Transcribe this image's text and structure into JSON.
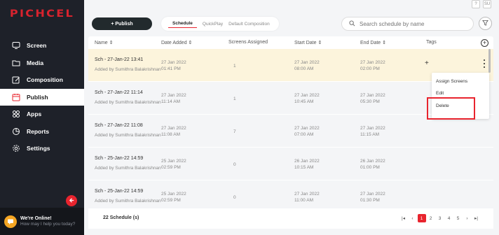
{
  "app": {
    "brand": "PICHCEL",
    "help_label": "?",
    "user_initials": "SU",
    "accent_color": "#e8242e",
    "sidebar_bg": "#1e2129"
  },
  "sidebar": {
    "items": [
      {
        "label": "Screen",
        "icon": "monitor-icon"
      },
      {
        "label": "Media",
        "icon": "folder-icon"
      },
      {
        "label": "Composition",
        "icon": "edit-icon"
      },
      {
        "label": "Publish",
        "icon": "calendar-icon",
        "active": true
      },
      {
        "label": "Apps",
        "icon": "apps-grid-icon"
      },
      {
        "label": "Reports",
        "icon": "pie-chart-icon"
      },
      {
        "label": "Settings",
        "icon": "gear-icon"
      }
    ],
    "chat": {
      "title": "We're Online!",
      "subtitle": "How may I help you today?"
    }
  },
  "toolbar": {
    "publish_label": "+ Publish",
    "tabs": [
      "Schedule",
      "QuickPlay",
      "Default Composition"
    ],
    "active_tab": "Schedule",
    "search_placeholder": "Search schedule by name"
  },
  "table": {
    "columns": [
      "Name",
      "Date Added",
      "Screens Assigned",
      "Start Date",
      "End Date",
      "Tags"
    ],
    "rows": [
      {
        "name": "Sch - 27-Jan-22 13:41",
        "added_by": "Added by Sumithra Balakrishnan",
        "date_added": "27 Jan 2022",
        "time_added": "01:41 PM",
        "screens": "1",
        "start_date": "27 Jan 2022",
        "start_time": "08:00 AM",
        "end_date": "27 Jan 2022",
        "end_time": "02:00 PM"
      },
      {
        "name": "Sch - 27-Jan-22 11:14",
        "added_by": "Added by Sumithra Balakrishnan",
        "date_added": "27 Jan 2022",
        "time_added": "11:14 AM",
        "screens": "1",
        "start_date": "27 Jan 2022",
        "start_time": "10:45 AM",
        "end_date": "27 Jan 2022",
        "end_time": "05:30 PM"
      },
      {
        "name": "Sch - 27-Jan-22 11:08",
        "added_by": "Added by Sumithra Balakrishnan",
        "date_added": "27 Jan 2022",
        "time_added": "11:08 AM",
        "screens": "7",
        "start_date": "27 Jan 2022",
        "start_time": "07:00 AM",
        "end_date": "27 Jan 2022",
        "end_time": "11:15 AM"
      },
      {
        "name": "Sch - 25-Jan-22 14:59",
        "added_by": "Added by Sumithra Balakrishnan",
        "date_added": "25 Jan 2022",
        "time_added": "02:59 PM",
        "screens": "0",
        "start_date": "26 Jan 2022",
        "start_time": "10:15 AM",
        "end_date": "26 Jan 2022",
        "end_time": "01:00 PM"
      },
      {
        "name": "Sch - 25-Jan-22 14:59",
        "added_by": "Added by Sumithra Balakrishnan",
        "date_added": "25 Jan 2022",
        "time_added": "02:59 PM",
        "screens": "0",
        "start_date": "27 Jan 2022",
        "start_time": "11:00 AM",
        "end_date": "27 Jan 2022",
        "end_time": "01:30 PM"
      }
    ],
    "row_tag_add": "+"
  },
  "context_menu": {
    "items": [
      "Assign Screens",
      "Edit",
      "Delete"
    ]
  },
  "footer": {
    "count_label": "22 Schedule (s)",
    "pages": [
      "1",
      "2",
      "3",
      "4",
      "5"
    ],
    "current_page": "1"
  }
}
